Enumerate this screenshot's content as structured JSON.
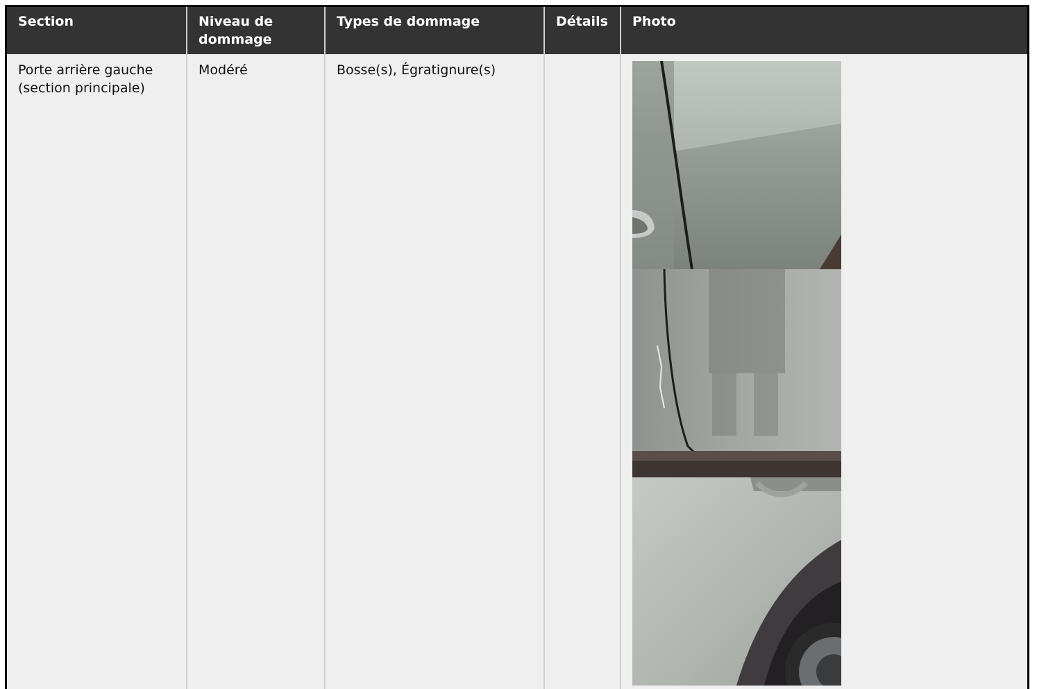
{
  "table": {
    "headers": [
      "Section",
      "Niveau de dommage",
      "Types de dommage",
      "Détails",
      "Photo"
    ],
    "rows": [
      {
        "section": "Porte arrière gauche (section principale)",
        "niveau": "Modéré",
        "types": "Bosse(s), Égratignure(s)",
        "details": ""
      }
    ]
  },
  "colors": {
    "header_bg": "#333333",
    "header_text": "#ffffff",
    "cell_bg": "#efefef"
  }
}
